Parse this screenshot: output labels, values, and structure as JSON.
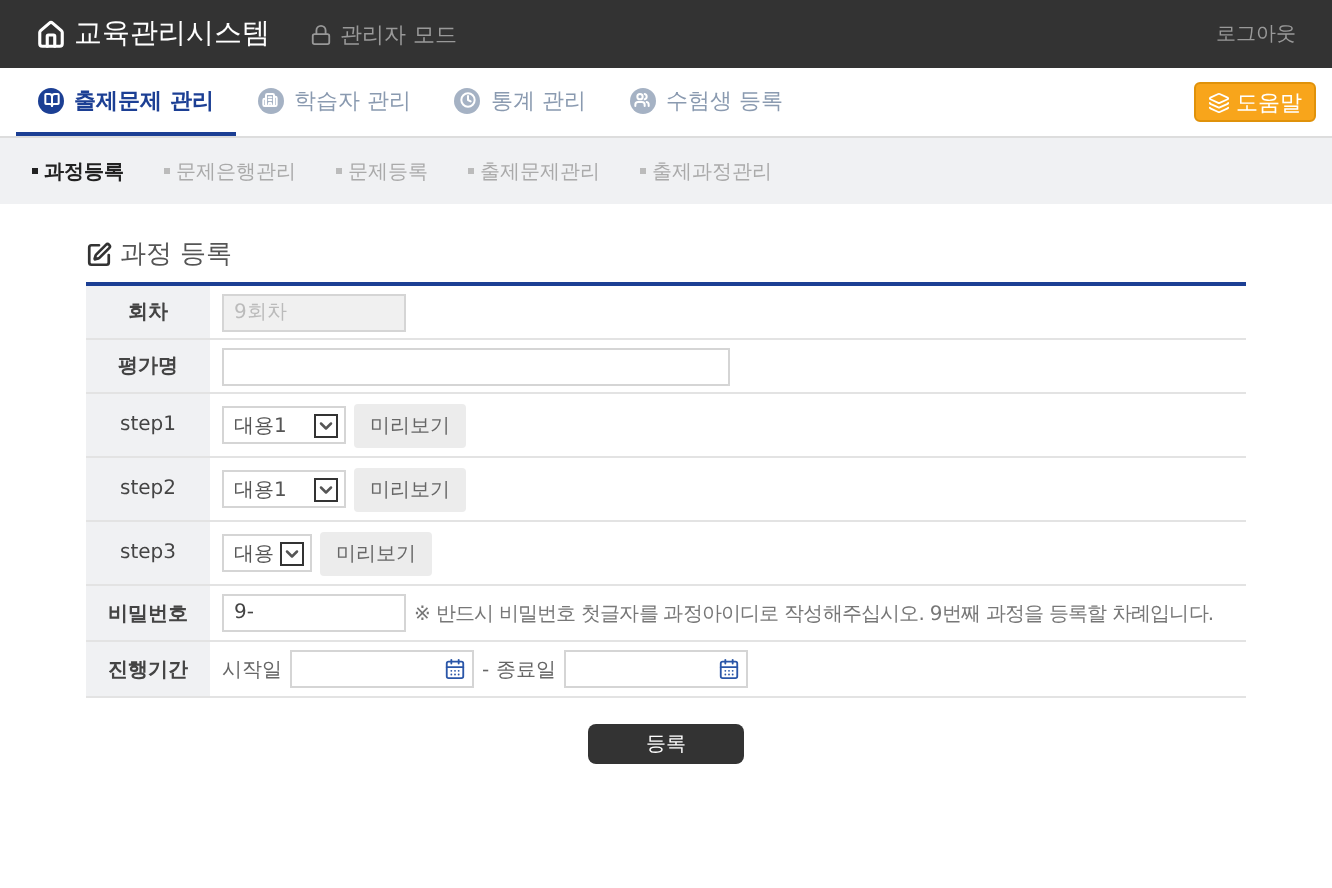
{
  "header": {
    "title": "교육관리시스템",
    "mode": "관리자 모드",
    "logout": "로그아웃"
  },
  "tabs": [
    {
      "label": "출제문제 관리",
      "selected": true
    },
    {
      "label": "학습자 관리",
      "selected": false
    },
    {
      "label": "통계 관리",
      "selected": false
    },
    {
      "label": "수험생 등록",
      "selected": false
    }
  ],
  "help_button": "도움말",
  "subnav": [
    {
      "label": "과정등록",
      "selected": true
    },
    {
      "label": "문제은행관리",
      "selected": false
    },
    {
      "label": "문제등록",
      "selected": false
    },
    {
      "label": "출제문제관리",
      "selected": false
    },
    {
      "label": "출제과정관리",
      "selected": false
    }
  ],
  "form": {
    "title": "과정 등록",
    "rows": [
      {
        "kind": "input",
        "label": "회차",
        "value": "9회차",
        "disabled": true
      },
      {
        "kind": "input",
        "label": "평가명",
        "disabled": false
      },
      {
        "kind": "select",
        "label": "step1",
        "value": "대용1",
        "button": "미리보기"
      },
      {
        "kind": "select",
        "label": "step2",
        "value": "대용1",
        "button": "미리보기"
      },
      {
        "kind": "select",
        "label": "step3",
        "value": "대용",
        "button": "미리보기"
      },
      {
        "kind": "password",
        "label": "비밀번호",
        "value": "9-",
        "note": "※ 반드시 비밀번호 첫글자를 과정아이디로 작성해주십시오. 9번째 과정을 등록할 차례입니다."
      },
      {
        "kind": "period",
        "label": "진행기간",
        "start_label": "시작일",
        "end_label": "- 종료일"
      }
    ]
  },
  "submit": "등록"
}
